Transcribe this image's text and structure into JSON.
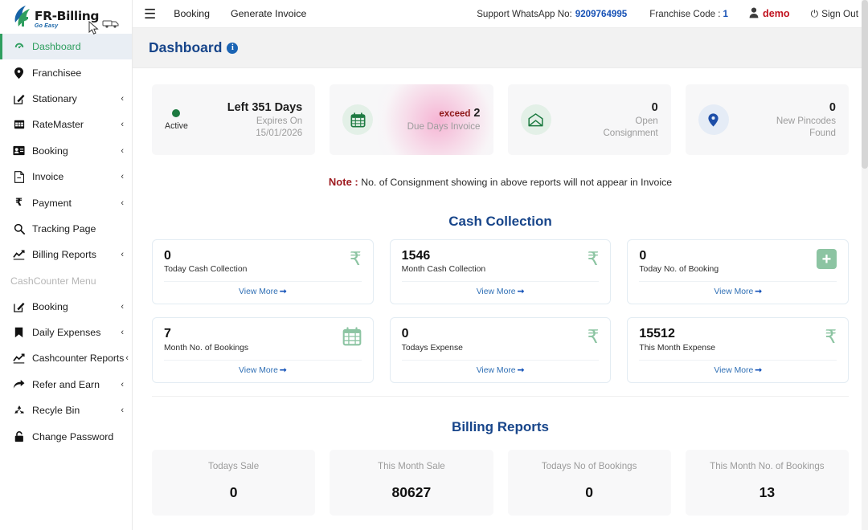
{
  "brand": {
    "title": "FR-Billing",
    "tagline": "Go Easy",
    "logo_icon": "flame-leaf-logo",
    "truck_icon": "delivery-truck-icon"
  },
  "sidebar": {
    "items": [
      {
        "label": "Dashboard",
        "icon": "dashboard-speedometer-icon",
        "chevron": "",
        "active": true
      },
      {
        "label": "Franchisee",
        "icon": "map-pin-icon",
        "chevron": "",
        "active": false
      },
      {
        "label": "Stationary",
        "icon": "pen-square-icon",
        "chevron": "‹",
        "active": false
      },
      {
        "label": "RateMaster",
        "icon": "table-grid-icon",
        "chevron": "‹",
        "active": false
      },
      {
        "label": "Booking",
        "icon": "id-card-icon",
        "chevron": "‹",
        "active": false
      },
      {
        "label": "Invoice",
        "icon": "file-document-icon",
        "chevron": "‹",
        "active": false
      },
      {
        "label": "Payment",
        "icon": "rupee-icon",
        "chevron": "‹",
        "active": false
      },
      {
        "label": "Tracking Page",
        "icon": "search-icon",
        "chevron": "",
        "active": false
      },
      {
        "label": "Billing Reports",
        "icon": "chart-line-icon",
        "chevron": "‹",
        "active": false
      }
    ],
    "section_label": "CashCounter Menu",
    "items2": [
      {
        "label": "Booking",
        "icon": "pen-square-icon",
        "chevron": "‹",
        "active": false
      },
      {
        "label": "Daily Expenses",
        "icon": "bookmark-icon",
        "chevron": "‹",
        "active": false
      },
      {
        "label": "Cashcounter Reports",
        "icon": "chart-line-icon",
        "chevron": "‹",
        "active": false
      },
      {
        "label": "Refer and Earn",
        "icon": "share-arrow-icon",
        "chevron": "‹",
        "active": false
      },
      {
        "label": "Recyle Bin",
        "icon": "recycle-icon",
        "chevron": "‹",
        "active": false
      },
      {
        "label": "Change Password",
        "icon": "lock-icon",
        "chevron": "",
        "active": false
      }
    ]
  },
  "topbar": {
    "menu_icon": "hamburger-menu-icon",
    "links": [
      {
        "label": "Booking"
      },
      {
        "label": "Generate Invoice"
      }
    ],
    "support_label": "Support WhatsApp No:",
    "support_number": "9209764995",
    "franchise_label": "Franchise Code :",
    "franchise_code": "1",
    "user_icon": "user-avatar-icon",
    "user_name": "demo",
    "signout_icon": "power-icon",
    "signout_label": "Sign Out"
  },
  "page": {
    "title": "Dashboard",
    "info_icon": "info-circle-icon",
    "note_label": "Note :",
    "note_text": "No. of Consignment showing in above reports will not appear in Invoice"
  },
  "status_cards": [
    {
      "type": "status",
      "status_dot": "green-dot",
      "status_label": "Active",
      "line1": "Left 351 Days",
      "line2": "Expires On",
      "line3": "15/01/2026"
    },
    {
      "type": "exceed",
      "icon": "calendar-icon",
      "exceed_label": "exceed",
      "value": "2",
      "label": "Due Days Invoice"
    },
    {
      "type": "count",
      "icon": "envelope-open-icon",
      "value": "0",
      "label_line1": "Open",
      "label_line2": "Consignment"
    },
    {
      "type": "count",
      "icon": "map-pin-icon",
      "value": "0",
      "label_line1": "New Pincodes",
      "label_line2": "Found"
    }
  ],
  "cash_collection": {
    "title": "Cash Collection",
    "view_more_label": "View More",
    "cards": [
      {
        "value": "0",
        "label": "Today Cash Collection",
        "icon": "rupee-icon"
      },
      {
        "value": "1546",
        "label": "Month Cash Collection",
        "icon": "rupee-icon"
      },
      {
        "value": "0",
        "label": "Today No. of Booking",
        "icon": "plus-square-icon"
      },
      {
        "value": "7",
        "label": "Month No. of Bookings",
        "icon": "calendar-icon"
      },
      {
        "value": "0",
        "label": "Todays Expense",
        "icon": "rupee-icon"
      },
      {
        "value": "15512",
        "label": "This Month Expense",
        "icon": "rupee-icon"
      }
    ]
  },
  "billing_reports": {
    "title": "Billing Reports",
    "cards": [
      {
        "label": "Todays Sale",
        "value": "0"
      },
      {
        "label": "This Month Sale",
        "value": "80627"
      },
      {
        "label": "Todays No of Bookings",
        "value": "0"
      },
      {
        "label": "This Month No. of Bookings",
        "value": "13"
      }
    ]
  },
  "colors": {
    "brand_green": "#2f9e5f",
    "heading_blue": "#17458a",
    "link_blue": "#2f6fb5",
    "alert_red": "#9e1b20",
    "user_red": "#c1121f",
    "icon_green": "#8cc4a2"
  }
}
